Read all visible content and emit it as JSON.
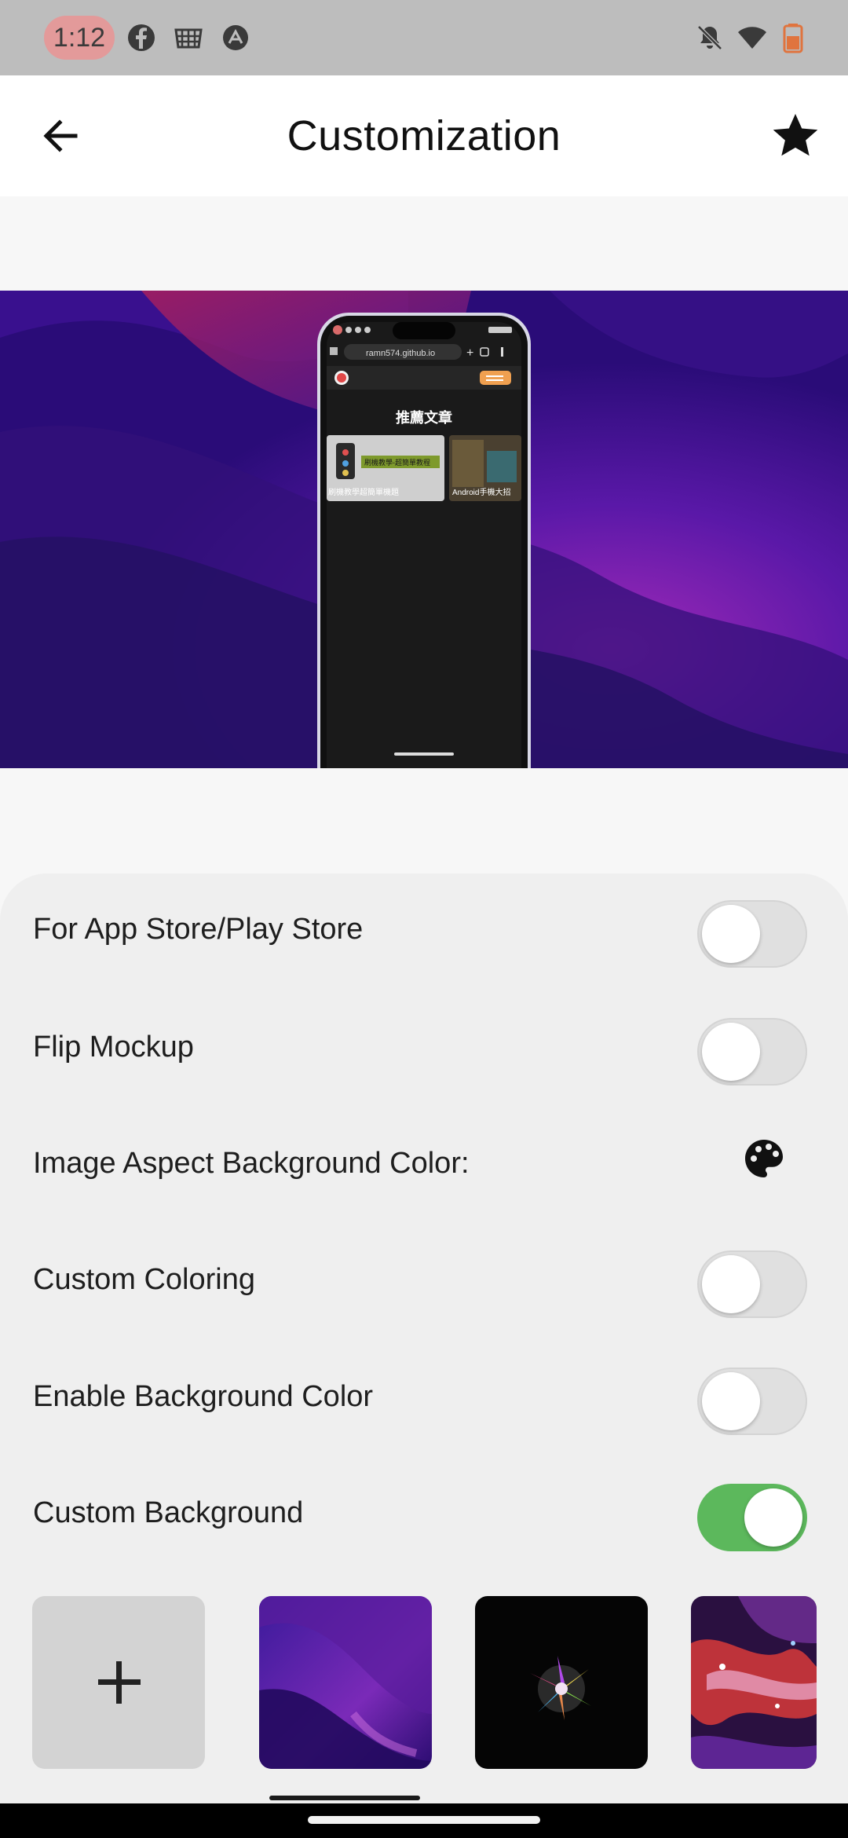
{
  "status_bar": {
    "time": "1:12",
    "left_icons": [
      "facebook-icon",
      "app-icon",
      "sync-icon"
    ],
    "right_icons": [
      "notifications-off-icon",
      "wifi-icon",
      "battery-icon"
    ]
  },
  "app_bar": {
    "title": "Customization",
    "back_icon": "arrow-back-icon",
    "action_icon": "star-icon"
  },
  "preview": {
    "mockup_url": "ramn574.github.io",
    "mockup_heading": "推薦文章",
    "mockup_cards": [
      {
        "caption": "刷機教學超簡單機題"
      },
      {
        "caption": "Android手機大招"
      }
    ],
    "mockup_banner": "刷機教學-超簡單教程"
  },
  "settings": [
    {
      "label": "For App Store/Play Store",
      "control": "switch",
      "on": false
    },
    {
      "label": "Flip Mockup",
      "control": "switch",
      "on": false
    },
    {
      "label": "Image Aspect Background Color:",
      "control": "palette-icon"
    },
    {
      "label": "Custom Coloring",
      "control": "switch",
      "on": false
    },
    {
      "label": "Enable Background Color",
      "control": "switch",
      "on": false
    },
    {
      "label": "Custom Background",
      "control": "switch",
      "on": true
    }
  ],
  "backgrounds": [
    {
      "name": "add-background",
      "icon": "plus-icon"
    },
    {
      "name": "purple-dunes"
    },
    {
      "name": "color-burst"
    },
    {
      "name": "neon-particles"
    }
  ],
  "colors": {
    "switch_on": "#5cb85c",
    "switch_off": "#e0e0e0",
    "sheet": "#efefef",
    "status_bar": "#bdbdbd",
    "time_pill": "#e39a9a"
  }
}
